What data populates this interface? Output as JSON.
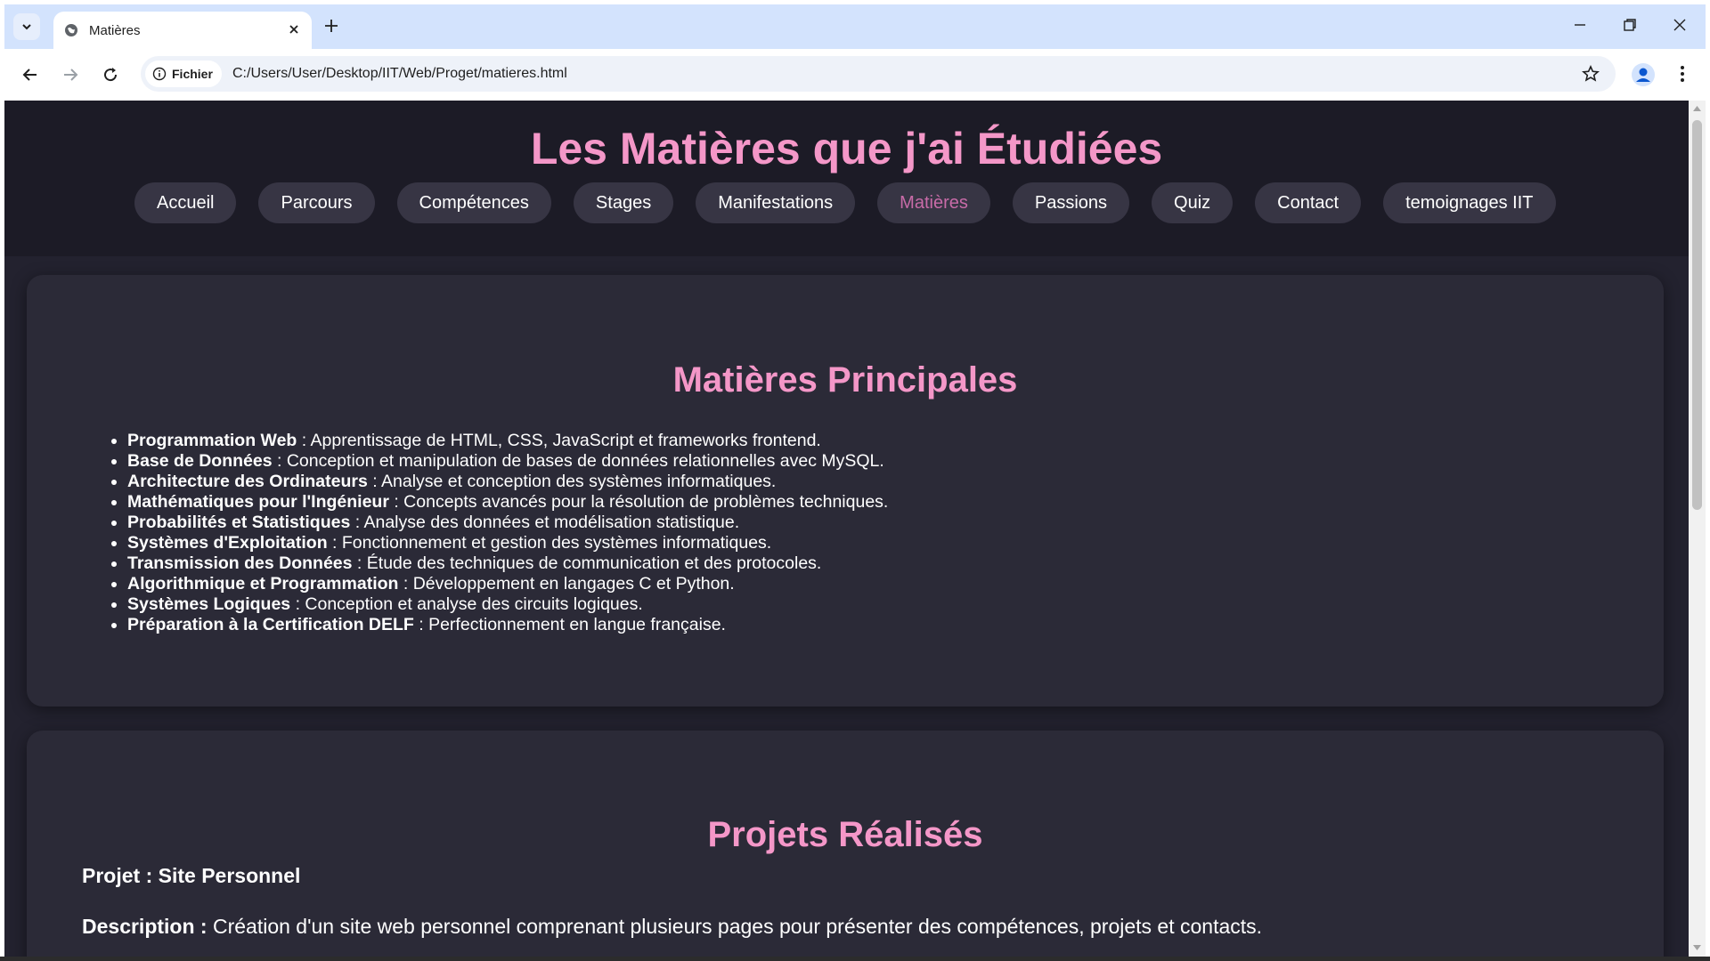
{
  "browser": {
    "tab_title": "Matières",
    "address_chip_label": "Fichier",
    "url": "C:/Users/User/Desktop/IIT/Web/Proget/matieres.html"
  },
  "site": {
    "title": "Les Matières que j'ai Étudiées",
    "nav": [
      {
        "label": "Accueil",
        "active": false
      },
      {
        "label": "Parcours",
        "active": false
      },
      {
        "label": "Compétences",
        "active": false
      },
      {
        "label": "Stages",
        "active": false
      },
      {
        "label": "Manifestations",
        "active": false
      },
      {
        "label": "Matières",
        "active": true
      },
      {
        "label": "Passions",
        "active": false
      },
      {
        "label": "Quiz",
        "active": false
      },
      {
        "label": "Contact",
        "active": false
      },
      {
        "label": "temoignages IIT",
        "active": false
      }
    ]
  },
  "main_subjects": {
    "heading": "Matières Principales",
    "items": [
      {
        "name": "Programmation Web",
        "description": " : Apprentissage de HTML, CSS, JavaScript et frameworks frontend."
      },
      {
        "name": "Base de Données",
        "description": " : Conception et manipulation de bases de données relationnelles avec MySQL."
      },
      {
        "name": "Architecture des Ordinateurs",
        "description": " : Analyse et conception des systèmes informatiques."
      },
      {
        "name": "Mathématiques pour l'Ingénieur",
        "description": " : Concepts avancés pour la résolution de problèmes techniques."
      },
      {
        "name": "Probabilités et Statistiques",
        "description": " : Analyse des données et modélisation statistique."
      },
      {
        "name": "Systèmes d'Exploitation",
        "description": " : Fonctionnement et gestion des systèmes informatiques."
      },
      {
        "name": "Transmission des Données",
        "description": " : Étude des techniques de communication et des protocoles."
      },
      {
        "name": "Algorithmique et Programmation",
        "description": " : Développement en langages C et Python."
      },
      {
        "name": "Systèmes Logiques",
        "description": " : Conception et analyse des circuits logiques."
      },
      {
        "name": "Préparation à la Certification DELF",
        "description": " : Perfectionnement en langue française."
      }
    ]
  },
  "projects": {
    "heading": "Projets Réalisés",
    "project_title": "Projet : Site Personnel",
    "description_label": "Description :",
    "description_text": " Création d'un site web personnel comprenant plusieurs pages pour présenter des compétences, projets et contacts."
  },
  "colors": {
    "accent_pink": "#f497c8",
    "active_nav": "#c86ba8",
    "page_bg": "#23222f",
    "header_bg": "#1c1b26",
    "card_bg": "#2b2a37",
    "nav_pill_bg": "#373544"
  }
}
